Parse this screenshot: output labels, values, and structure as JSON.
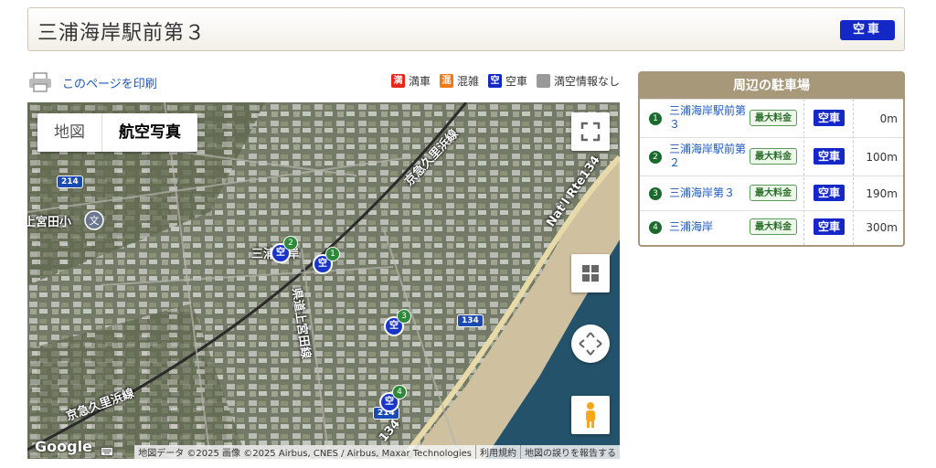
{
  "header": {
    "title": "三浦海岸駅前第３",
    "status_badge": "空車"
  },
  "print": {
    "link_label": "このページを印刷"
  },
  "legend": [
    {
      "icon": "満",
      "label": "満車",
      "color": "#e8261e"
    },
    {
      "icon": "混",
      "label": "混雑",
      "color": "#ee7a1a"
    },
    {
      "icon": "空",
      "label": "空車",
      "color": "#1428c8"
    },
    {
      "icon": "",
      "label": "満空情報なし",
      "color": "#999999"
    }
  ],
  "map": {
    "type_map": "地図",
    "type_satellite": "航空写真",
    "labels": {
      "school": "上宮田小",
      "station": "三浦海岸",
      "rail_top": "京急久里浜線",
      "rail_bottom": "京急久里浜線",
      "road_vertical": "県道上宮田線",
      "natl_rte": "Nat'l Rte134",
      "rte134_bottom": "134"
    },
    "road_shields": {
      "r214_top": "214",
      "r134_mid": "134",
      "r214_bottom": "214"
    },
    "markers": [
      {
        "num": "1",
        "icon": "空"
      },
      {
        "num": "2",
        "icon": "空"
      },
      {
        "num": "3",
        "icon": "空"
      },
      {
        "num": "4",
        "icon": "空"
      }
    ],
    "google": "Google",
    "attribution": [
      "地図データ ©2025 画像 ©2025 Airbus, CNES / Airbus, Maxar Technologies",
      "利用規約",
      "地図の誤りを報告する"
    ]
  },
  "sidebar": {
    "title": "周辺の駐車場",
    "items": [
      {
        "num": "1",
        "name": "三浦海岸駅前第３",
        "tag": "最大料金",
        "status": "空車",
        "distance": "0m"
      },
      {
        "num": "2",
        "name": "三浦海岸駅前第２",
        "tag": "最大料金",
        "status": "空車",
        "distance": "100m"
      },
      {
        "num": "3",
        "name": "三浦海岸第３",
        "tag": "最大料金",
        "status": "空車",
        "distance": "190m"
      },
      {
        "num": "4",
        "name": "三浦海岸",
        "tag": "最大料金",
        "status": "空車",
        "distance": "300m"
      }
    ]
  }
}
